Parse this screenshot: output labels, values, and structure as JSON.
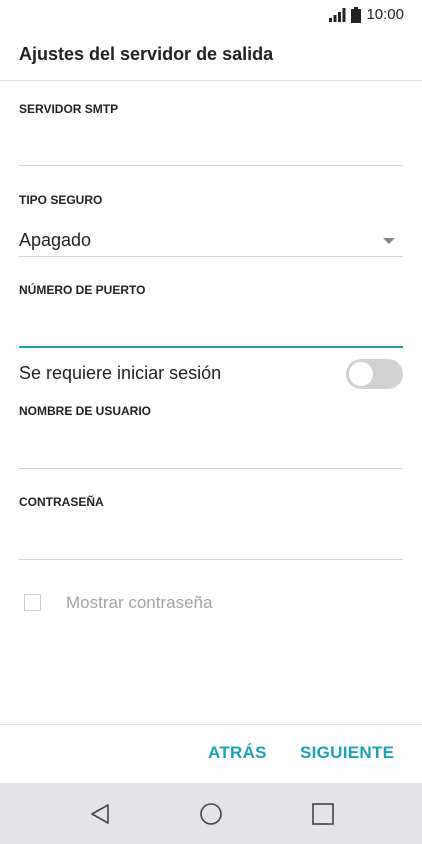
{
  "status_bar": {
    "time": "10:00",
    "icons": [
      "signal-icon",
      "battery-icon"
    ]
  },
  "header": {
    "title": "Ajustes del servidor de salida"
  },
  "form": {
    "smtp_server": {
      "label": "SERVIDOR SMTP",
      "value": ""
    },
    "security_type": {
      "label": "TIPO SEGURO",
      "value": "Apagado"
    },
    "port_number": {
      "label": "NÚMERO DE PUERTO",
      "value": ""
    },
    "require_signin": {
      "label": "Se requiere iniciar sesión",
      "enabled": false
    },
    "username": {
      "label": "NOMBRE DE USUARIO",
      "value": ""
    },
    "password": {
      "label": "CONTRASEÑA",
      "value": ""
    },
    "show_password": {
      "label": "Mostrar contraseña",
      "checked": false
    }
  },
  "actions": {
    "back": "ATRÁS",
    "next": "SIGUIENTE"
  },
  "nav": {
    "icons": [
      "back-triangle-icon",
      "home-circle-icon",
      "recents-square-icon"
    ]
  },
  "colors": {
    "accent": "#17a3b2",
    "nav_background": "#e4e4e8"
  }
}
